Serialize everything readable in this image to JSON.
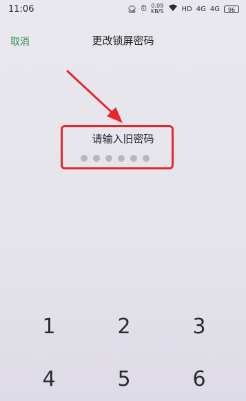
{
  "status_bar": {
    "time": "11:06",
    "net_speed_value": "0.09",
    "net_speed_unit": "KB/S",
    "network_hd": "HD",
    "signal_1": "4G",
    "signal_2": "4G",
    "battery": "96"
  },
  "header": {
    "cancel_label": "取消",
    "title": "更改锁屏密码"
  },
  "password": {
    "prompt": "请输入旧密码",
    "entered_digits": 6
  },
  "keypad": {
    "keys": [
      "1",
      "2",
      "3",
      "4",
      "5",
      "6"
    ]
  },
  "annotation": {
    "color": "#e8262a"
  }
}
